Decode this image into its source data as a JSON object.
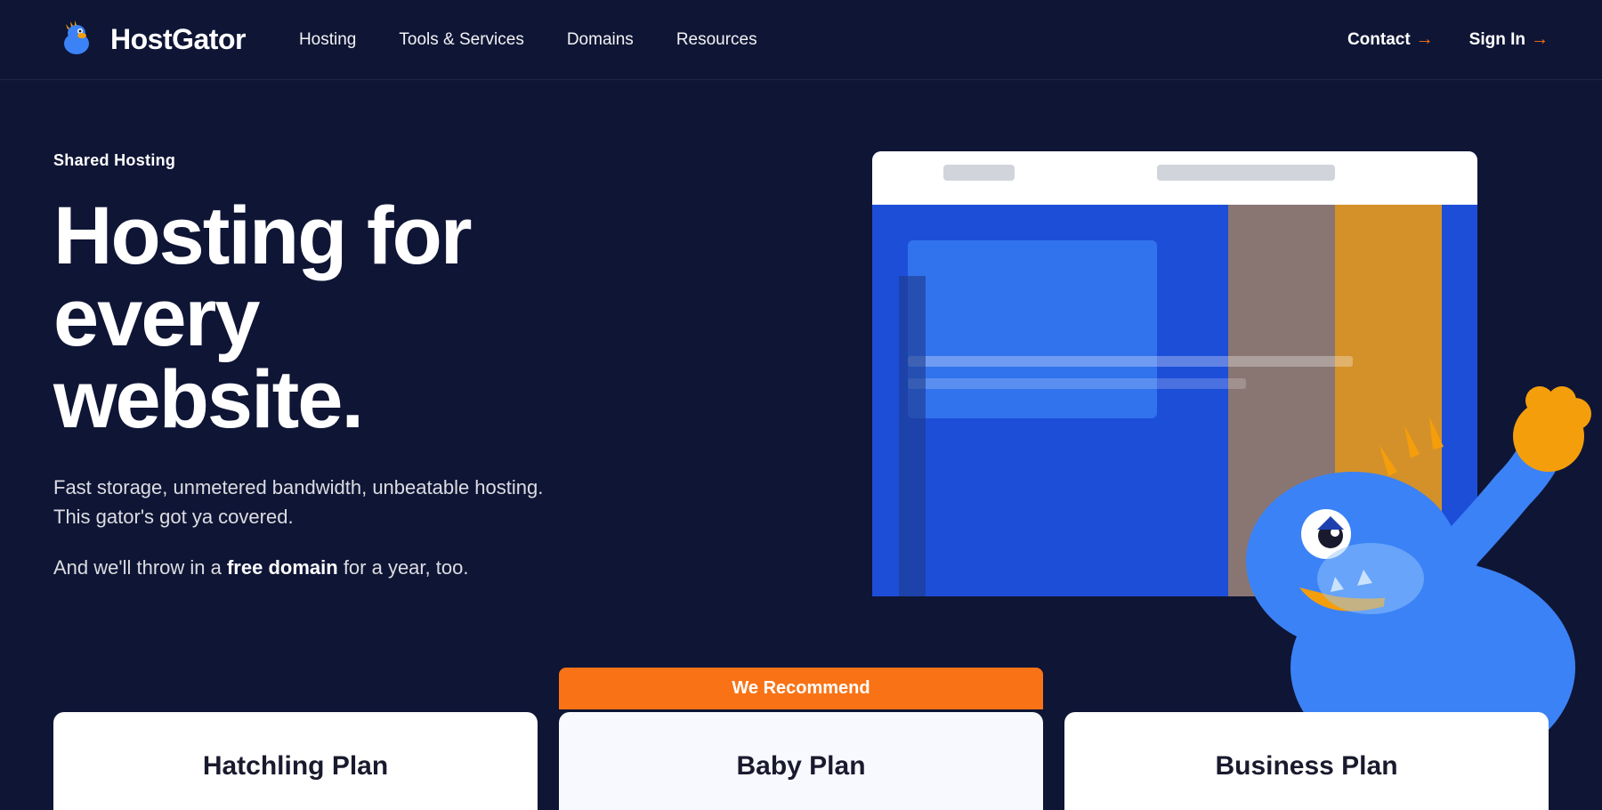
{
  "logo": {
    "text": "HostGator"
  },
  "nav": {
    "links": [
      {
        "id": "hosting",
        "label": "Hosting"
      },
      {
        "id": "tools-services",
        "label": "Tools & Services"
      },
      {
        "id": "domains",
        "label": "Domains"
      },
      {
        "id": "resources",
        "label": "Resources"
      }
    ],
    "right": [
      {
        "id": "contact",
        "label": "Contact",
        "arrow": "→"
      },
      {
        "id": "signin",
        "label": "Sign In",
        "arrow": "→"
      }
    ]
  },
  "hero": {
    "eyebrow": "Shared Hosting",
    "title": "Hosting for every website.",
    "desc": "Fast storage, unmetered bandwidth, unbeatable hosting. This gator's got ya covered.",
    "free_domain": "And we'll throw in a",
    "free_domain_bold": "free domain",
    "free_domain_suffix": "for a year, too."
  },
  "pricing": {
    "recommend_label": "We Recommend",
    "plans": [
      {
        "id": "hatchling",
        "label": "Hatchling Plan",
        "featured": false
      },
      {
        "id": "baby",
        "label": "Baby Plan",
        "featured": true
      },
      {
        "id": "business",
        "label": "Business Plan",
        "featured": false
      }
    ]
  },
  "colors": {
    "bg": "#0f1535",
    "accent_orange": "#f97316",
    "nav_link": "#ffffff",
    "card_bg": "#ffffff",
    "card_featured_bg": "#f8f9ff"
  }
}
